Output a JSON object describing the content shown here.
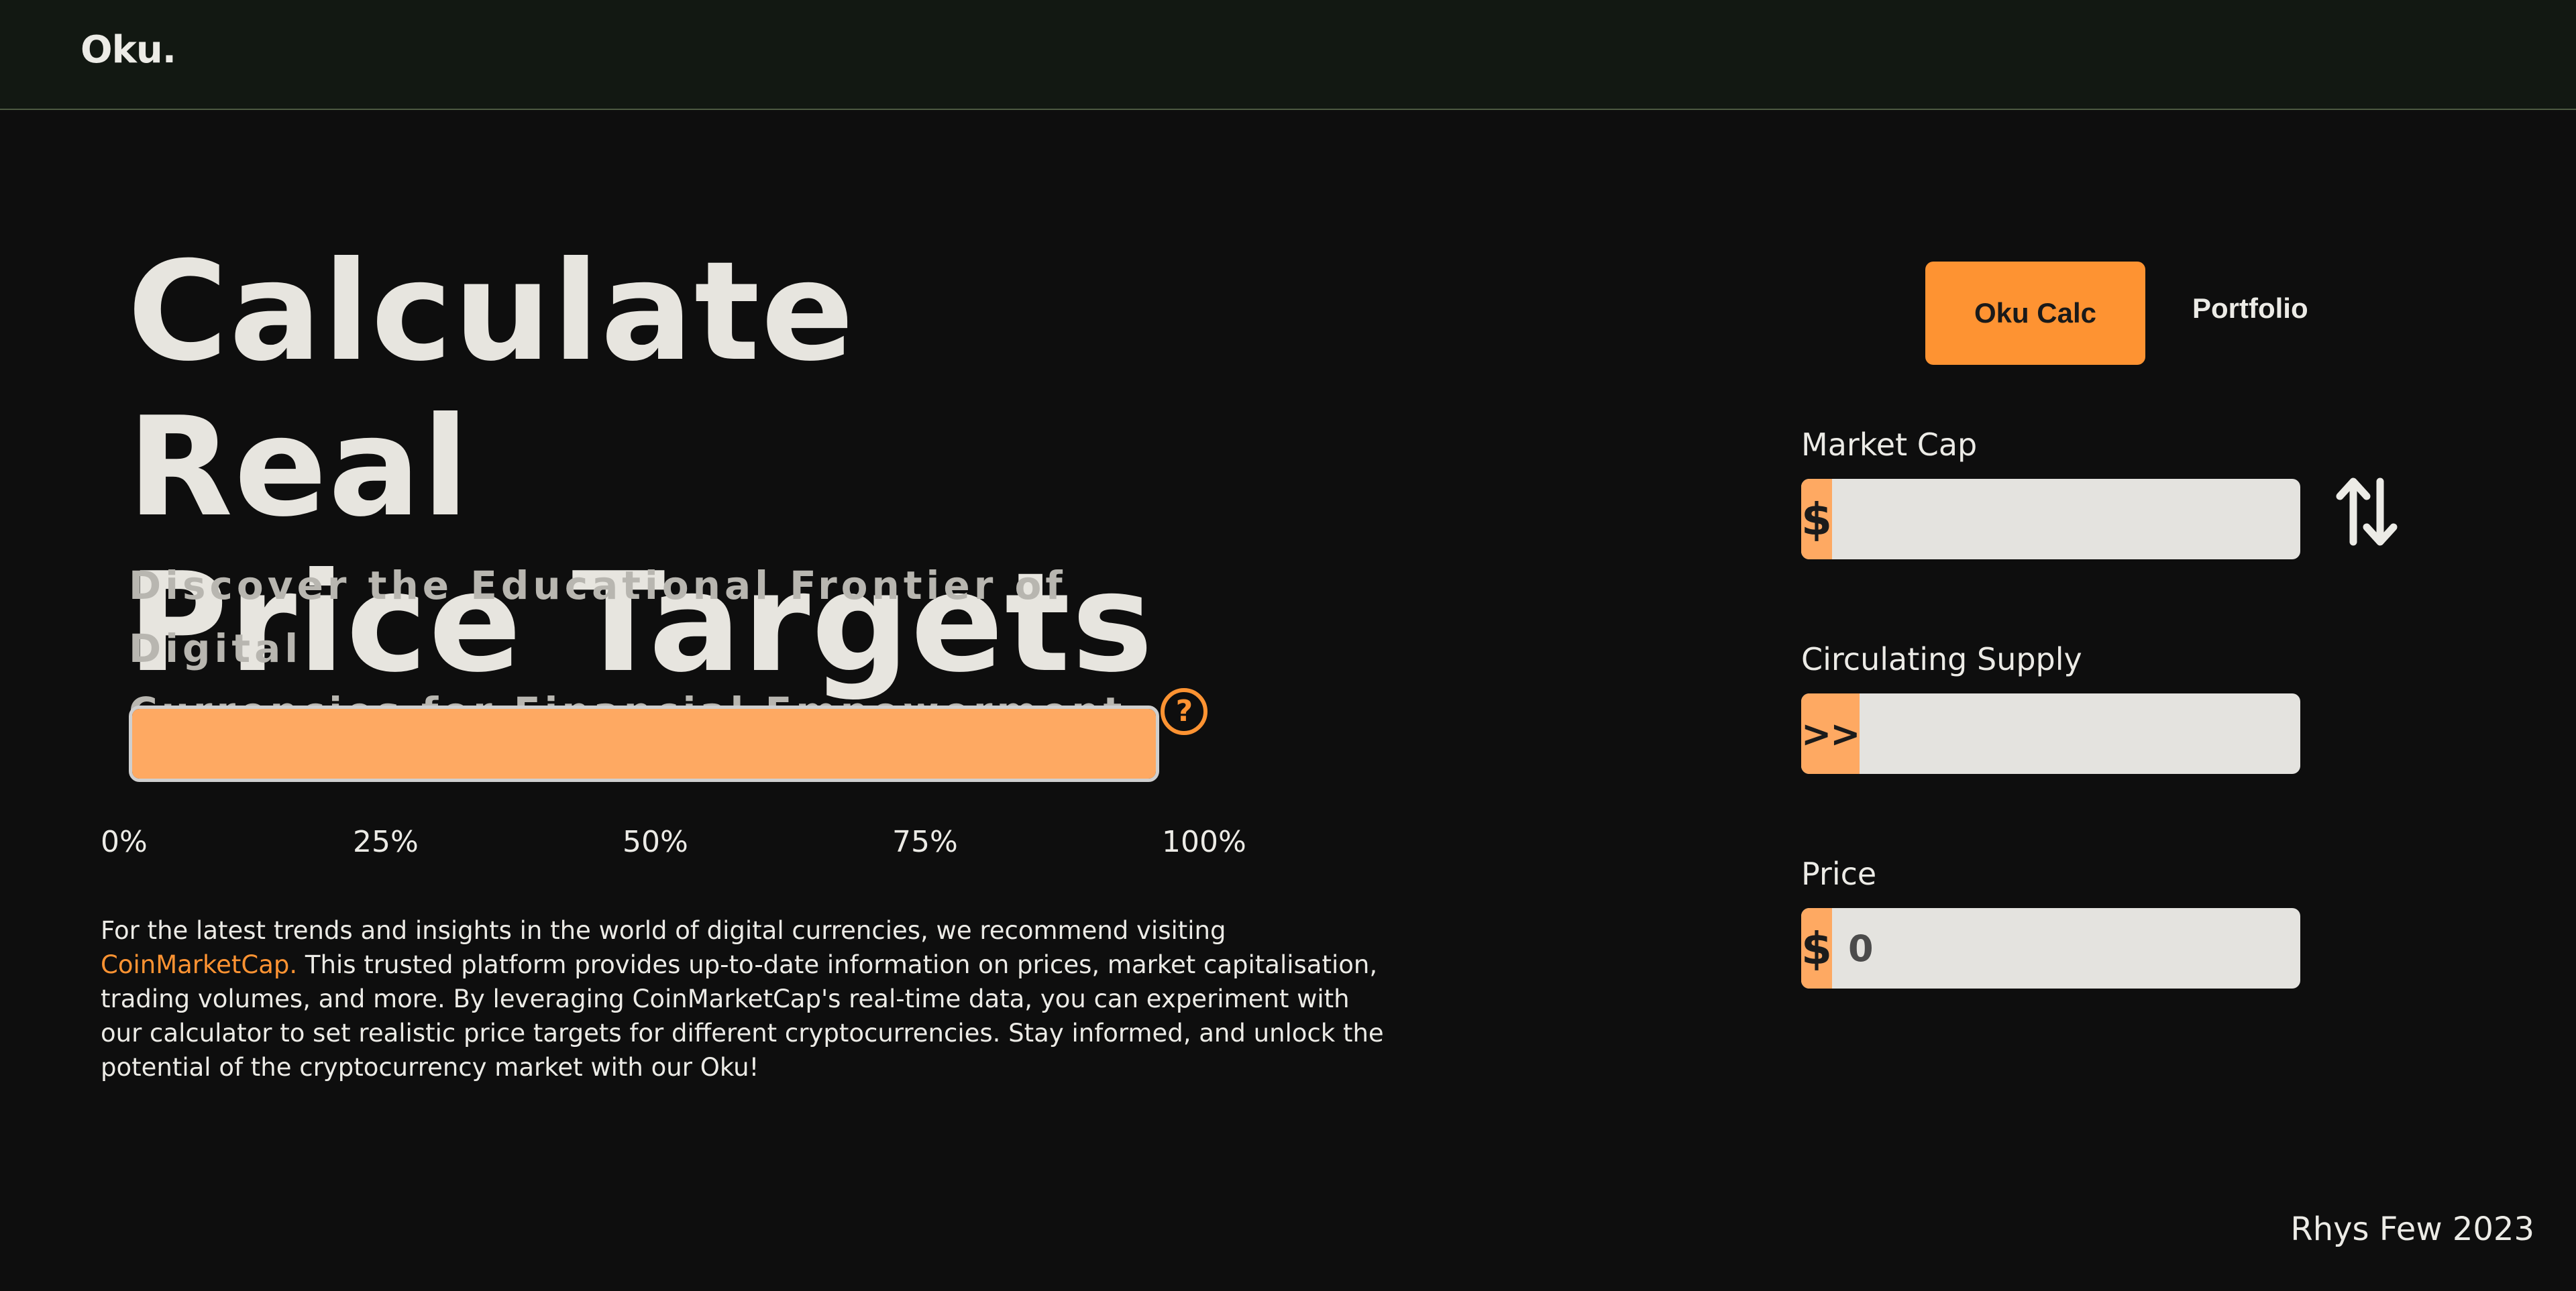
{
  "header": {
    "logo": "Oku."
  },
  "hero": {
    "title_line1": "Calculate Real",
    "title_line2": "Price Targets",
    "subtitle_line1": "Discover the Educational Frontier of Digital",
    "subtitle_line2": "Currencies for Financial Empowerment.",
    "help_icon": "?"
  },
  "progress": {
    "value_percent": 100,
    "fill_color": "#fea962",
    "ticks": [
      "0%",
      "25%",
      "50%",
      "75%",
      "100%"
    ]
  },
  "info": {
    "text_before": "For the latest trends and insights in the world of digital currencies, we recommend visiting ",
    "link": "CoinMarketCap.",
    "text_after": " This trusted platform provides up-to-date information on prices, market capitalisation, trading volumes, and more. By leveraging CoinMarketCap's real-time data, you can experiment with our calculator to set realistic price targets for different cryptocurrencies. Stay informed, and unlock the potential of the cryptocurrency market with our Oku!"
  },
  "tabs": {
    "active": "Oku Calc",
    "inactive": "Portfolio"
  },
  "fields": {
    "market_cap": {
      "label": "Market Cap",
      "prefix": "$",
      "value": ""
    },
    "circulating_supply": {
      "label": "Circulating Supply",
      "prefix": ">>",
      "value": ""
    },
    "price": {
      "label": "Price",
      "prefix": "$",
      "placeholder": "0"
    }
  },
  "icons": {
    "swap": "swap-vertical-icon",
    "help": "question-circle-icon"
  },
  "colors": {
    "accent": "#fe9332",
    "accent_light": "#fea962",
    "background": "#0e0e0e",
    "header_bg": "#121812"
  },
  "footer": {
    "credit": "Rhys Few 2023"
  }
}
